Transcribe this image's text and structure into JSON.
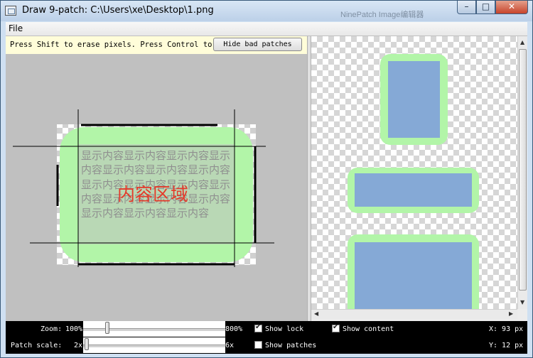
{
  "window": {
    "title": "Draw 9-patch: C:\\Users\\xe\\Desktop\\1.png",
    "behind_title": "NinePatch Image编辑器",
    "minimize_glyph": "–",
    "maximize_glyph": "□",
    "close_glyph": "✕"
  },
  "menu": {
    "file_label": "File"
  },
  "editor": {
    "help_text": "Press Shift to erase pixels. Press Control to draw layout bounds",
    "help_button_label": "Hide bad patches",
    "sample_text": "显示内容显示内容显示内容显示内容显示内容显示内容显示内容显示内容显示内容显示内容显示内容显示内容显示内容显示内容显示内容显示内容显示内容",
    "content_area_label": "内容区域"
  },
  "controls": {
    "zoom_label": "Zoom:",
    "zoom_min": "100%",
    "zoom_max": "800%",
    "zoom_value": 0.15,
    "patch_scale_label": "Patch scale:",
    "patch_scale_min": "2x",
    "patch_scale_max": "6x",
    "patch_scale_value": 0.0,
    "show_lock_label": "Show lock",
    "show_lock_checked": true,
    "show_patches_label": "Show patches",
    "show_patches_checked": false,
    "show_content_label": "Show content",
    "show_content_checked": true,
    "x_readout": "X: 93 px",
    "y_readout": "Y: 12 px"
  },
  "colors": {
    "patch_green": "#b2f5a8",
    "content_blue": "#85a9d6",
    "editor_bg": "#c0c0c0",
    "content_label_red": "#e53a2a"
  }
}
